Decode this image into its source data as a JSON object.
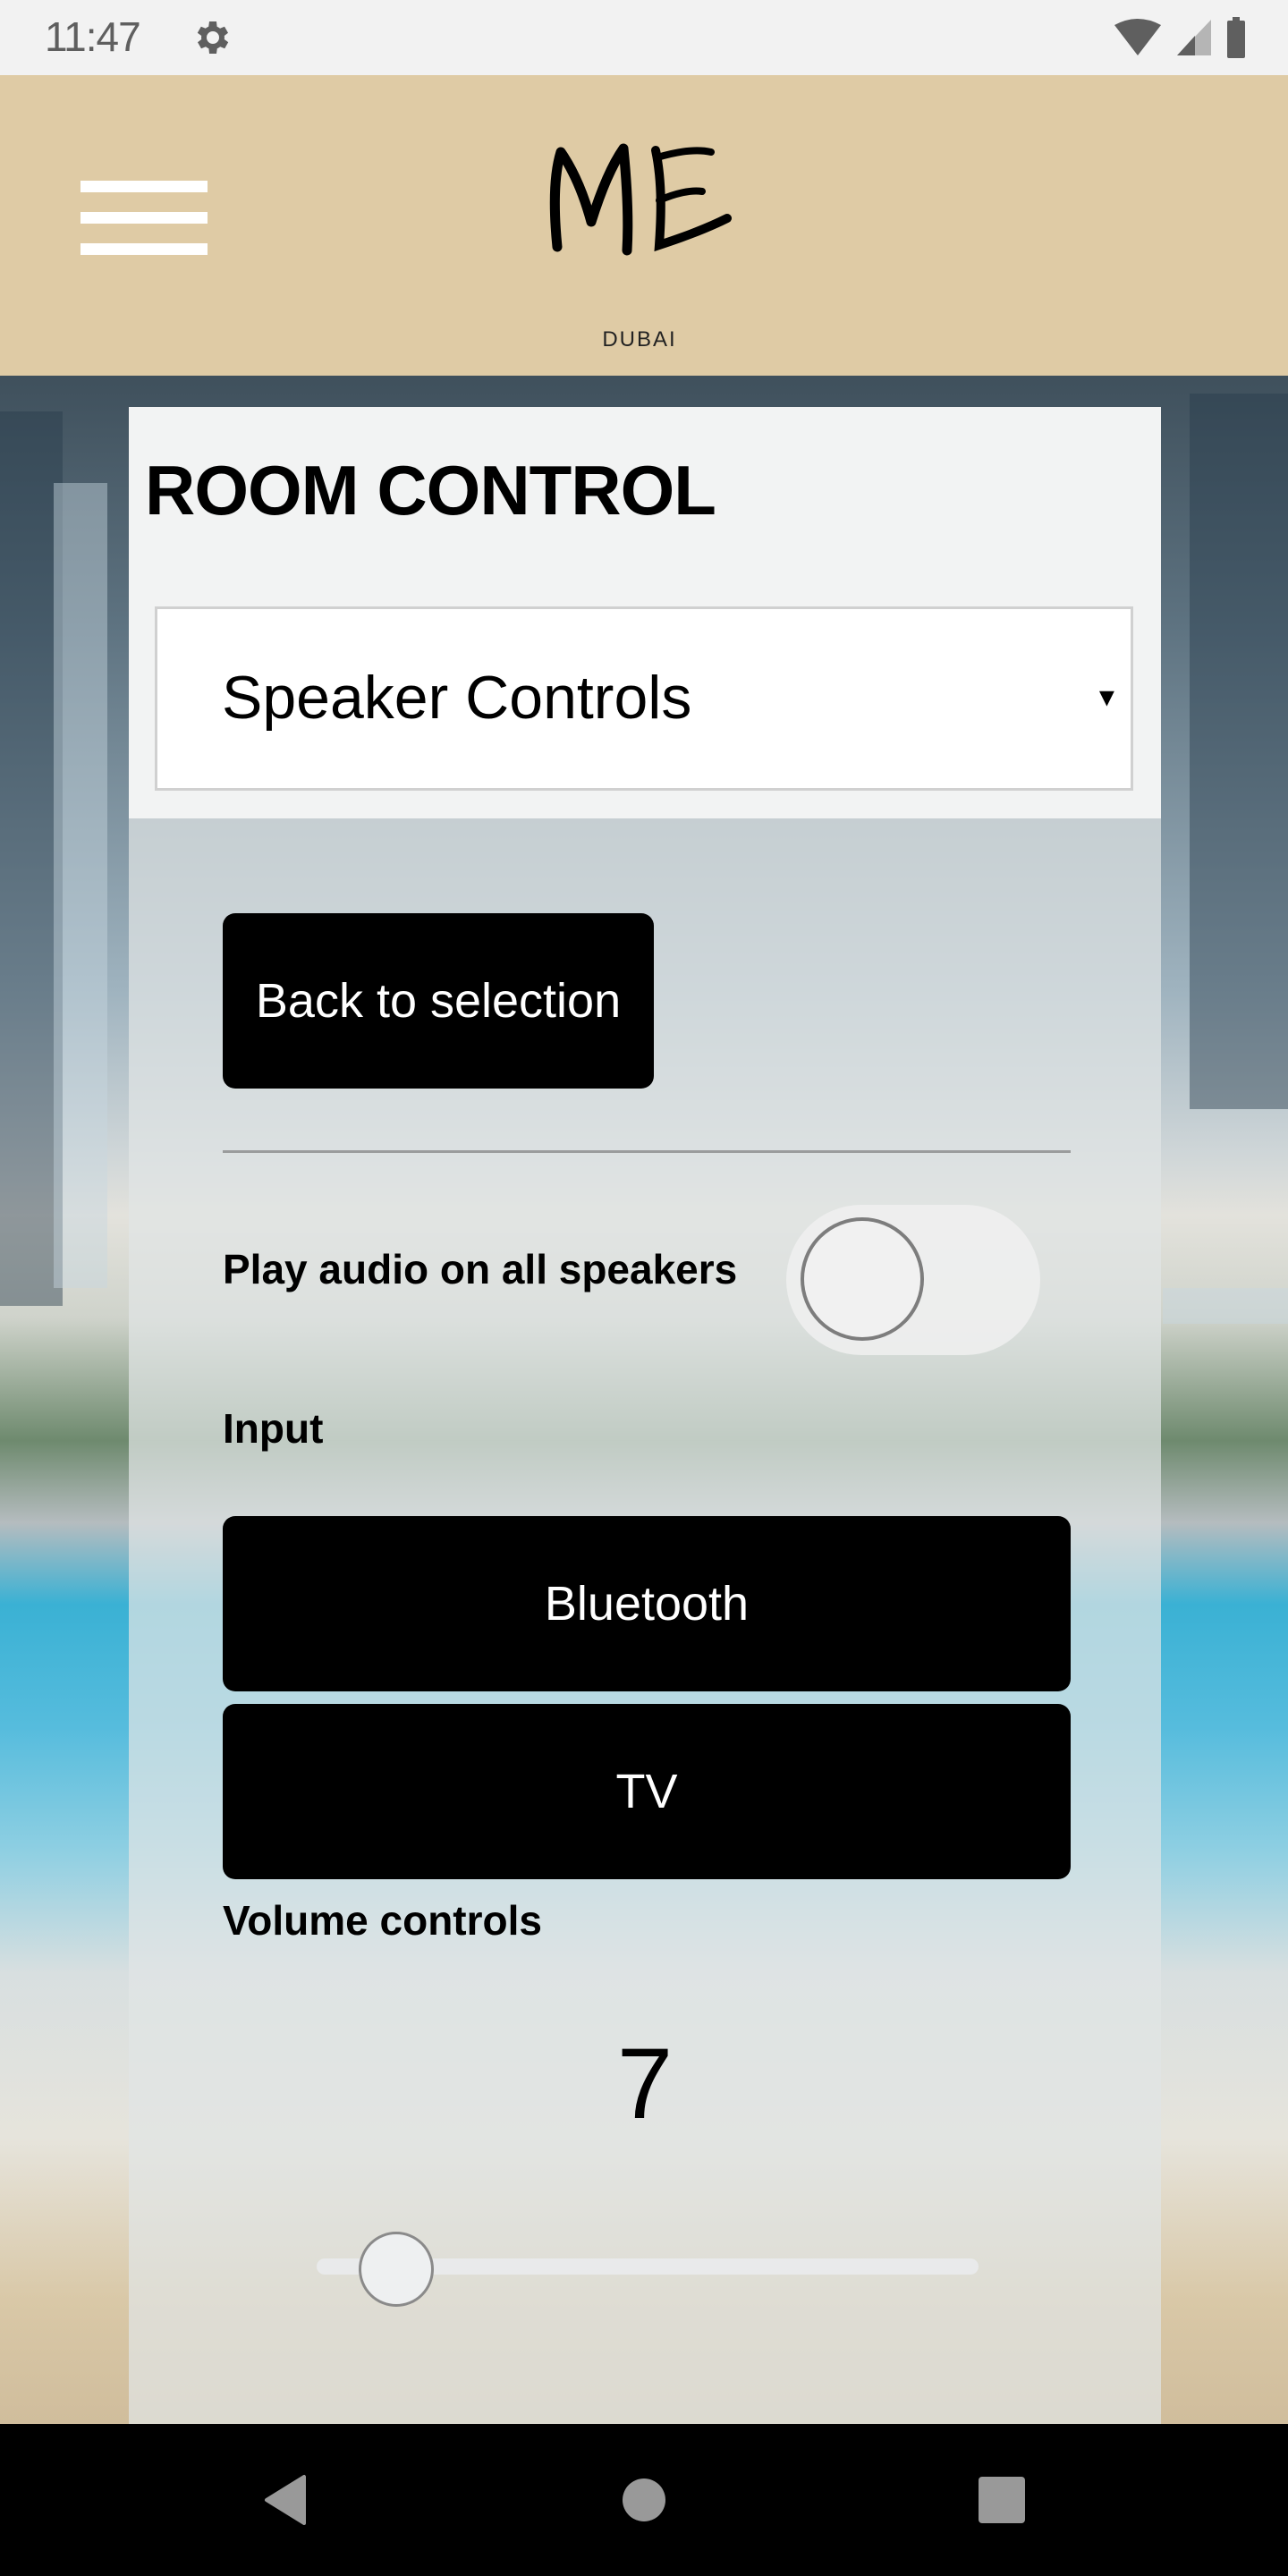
{
  "status_bar": {
    "time": "11:47",
    "icons": [
      "gear-icon",
      "wifi-icon",
      "signal-icon",
      "battery-icon"
    ]
  },
  "header": {
    "menu_icon": "hamburger-menu-icon",
    "logo_text": "ME",
    "logo_subtitle": "DUBAI",
    "brand_color": "#dfcba5"
  },
  "page": {
    "title": "ROOM CONTROL",
    "select": {
      "selected": "Speaker Controls",
      "arrow": "▾"
    },
    "back_button": "Back to selection",
    "all_speakers": {
      "label": "Play audio on all speakers",
      "enabled": false
    },
    "input": {
      "label": "Input",
      "options": [
        "Bluetooth",
        "TV"
      ]
    },
    "volume": {
      "label": "Volume controls",
      "value": "7",
      "slider_fraction": 0.12
    }
  },
  "nav_bar": {
    "buttons": [
      "back-icon",
      "home-icon",
      "recent-apps-icon"
    ]
  }
}
